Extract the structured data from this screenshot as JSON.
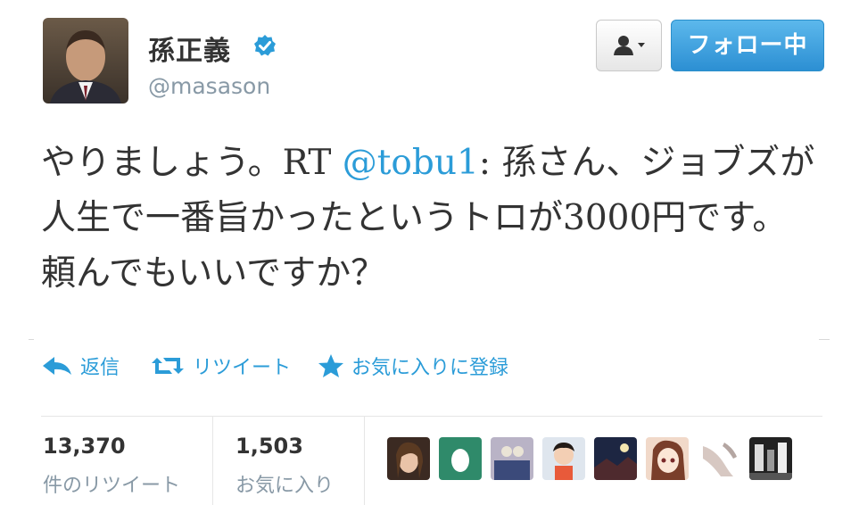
{
  "author": {
    "display_name": "孫正義",
    "handle": "@masason",
    "avatar_icon": "profile-photo",
    "verified_icon": "verified-badge-icon"
  },
  "header_actions": {
    "user_menu_icon": "user-dropdown-icon",
    "follow_label": "フォロー中"
  },
  "tweet": {
    "text_before": "やりましょう。RT ",
    "mention": "@tobu1",
    "text_after": ": 孫さん、ジョブズが人生で一番旨かったというトロが3000円です。頼んでもいいですか？"
  },
  "actions": {
    "reply_label": "返信",
    "retweet_label": "リツイート",
    "favorite_label": "お気に入りに登録"
  },
  "stats": {
    "retweets_count": "13,370",
    "retweets_label": "件のリツイート",
    "favorites_count": "1,503",
    "favorites_label": "お気に入り"
  },
  "colors": {
    "link_blue": "#2b9cd8",
    "follow_button": "#2c8fd3",
    "muted_gray": "#8899a6",
    "text": "#333333"
  }
}
